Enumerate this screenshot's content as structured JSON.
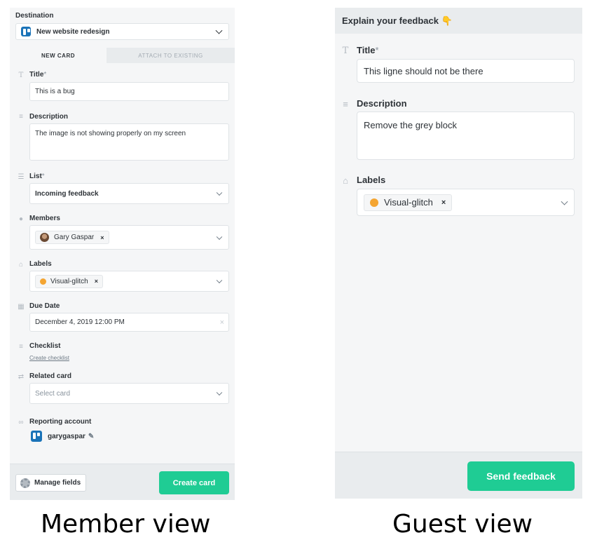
{
  "member": {
    "destination_label": "Destination",
    "destination_value": "New website redesign",
    "tabs": {
      "new_card": "NEW CARD",
      "attach": "ATTACH TO EXISTING"
    },
    "title": {
      "label": "Title",
      "required": "*",
      "value": "This is a bug"
    },
    "description": {
      "label": "Description",
      "value": "The image is not showing properly on my screen"
    },
    "list": {
      "label": "List",
      "required": "*",
      "value": "Incoming feedback"
    },
    "members": {
      "label": "Members",
      "chip": "Gary Gaspar",
      "remove": "×"
    },
    "labels": {
      "label": "Labels",
      "chip": "Visual-glitch",
      "remove": "×",
      "chip_color": "#f4a532"
    },
    "due_date": {
      "label": "Due Date",
      "value": "December 4, 2019 12:00 PM",
      "clear": "×"
    },
    "checklist": {
      "label": "Checklist",
      "link": "Create checklist"
    },
    "related_card": {
      "label": "Related card",
      "placeholder": "Select card"
    },
    "reporting_account": {
      "label": "Reporting account",
      "username": "garygaspar"
    },
    "manage_fields": "Manage fields",
    "create_card": "Create card",
    "accent_color": "#1fcc94"
  },
  "guest": {
    "header": "Explain your feedback 👇",
    "title": {
      "label": "Title",
      "required": "*",
      "value": "This ligne should not be there"
    },
    "description": {
      "label": "Description",
      "value": "Remove the grey block"
    },
    "labels": {
      "label": "Labels",
      "chip": "Visual-glitch",
      "remove": "×"
    },
    "send": "Send feedback"
  },
  "captions": {
    "member": "Member view",
    "guest": "Guest view"
  }
}
